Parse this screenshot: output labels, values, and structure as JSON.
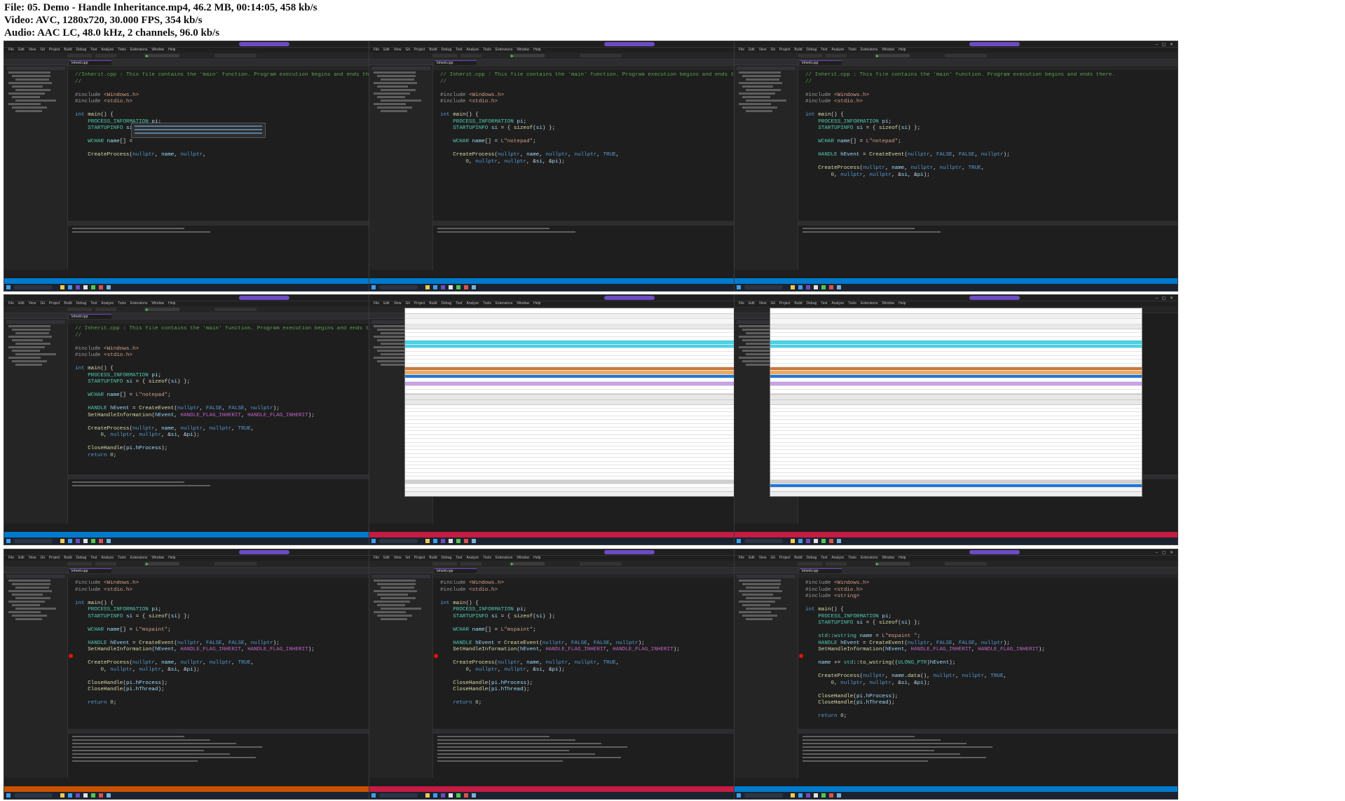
{
  "info": {
    "file_line": "File: 05. Demo - Handle Inheritance.mp4, 46.2 MB, 00:14:05, 458 kb/s",
    "video_line": "Video: AVC, 1280x720, 30.000 FPS, 354 kb/s",
    "audio_line": "Audio: AAC LC, 48.0 kHz, 2 channels, 96.0 kb/s"
  },
  "ide": {
    "menu": [
      "File",
      "Edit",
      "View",
      "Git",
      "Project",
      "Build",
      "Debug",
      "Test",
      "Analyze",
      "Tools",
      "Extensions",
      "Window",
      "Help"
    ],
    "tab_label": "Inherit.cpp",
    "accent": "#6d4bc3",
    "status_colors": {
      "normal": "#007acc",
      "debug": "#ca5100",
      "alt": "#c41c43"
    }
  },
  "frames": [
    {
      "id": "f1",
      "kind": "code",
      "status": "normal",
      "lines": [
        "//Inherit.cpp : This file contains the 'main' function. Program execution begins and ends there.",
        "//",
        "",
        "#include <Windows.h>",
        "#include <stdio.h>",
        "",
        "int main() {",
        "    PROCESS_INFORMATION pi;",
        "    STARTUPINFO si = { sizeof(si) };",
        "",
        "    WCHAR name[] =",
        "",
        "    CreateProcess(nullptr, name, nullptr,"
      ],
      "tooltip": true
    },
    {
      "id": "f2",
      "kind": "code",
      "status": "normal",
      "lines": [
        "// Inherit.cpp : This file contains the 'main' function. Program execution begins and ends there.",
        "//",
        "",
        "#include <Windows.h>",
        "#include <stdio.h>",
        "",
        "int main() {",
        "    PROCESS_INFORMATION pi;",
        "    STARTUPINFO si = { sizeof(si) };",
        "",
        "    WCHAR name[] = L\"notepad\";",
        "",
        "    CreateProcess(nullptr, name, nullptr, nullptr, TRUE,",
        "        0, nullptr, nullptr, &si, &pi);"
      ]
    },
    {
      "id": "f3",
      "kind": "code",
      "status": "normal",
      "lines": [
        "// Inherit.cpp : This file contains the 'main' function. Program execution begins and ends there.",
        "//",
        "",
        "#include <Windows.h>",
        "#include <stdio.h>",
        "",
        "int main() {",
        "    PROCESS_INFORMATION pi;",
        "    STARTUPINFO si = { sizeof(si) };",
        "",
        "    WCHAR name[] = L\"notepad\";",
        "",
        "    HANDLE hEvent = CreateEvent(nullptr, FALSE, FALSE, nullptr);",
        "",
        "    CreateProcess(nullptr, name, nullptr, nullptr, TRUE,",
        "        0, nullptr, nullptr, &si, &pi);"
      ]
    },
    {
      "id": "f4",
      "kind": "code",
      "status": "normal",
      "lines": [
        "// Inherit.cpp : This file contains the 'main' function. Program execution begins and ends there.",
        "//",
        "",
        "#include <Windows.h>",
        "#include <stdio.h>",
        "",
        "int main() {",
        "    PROCESS_INFORMATION pi;",
        "    STARTUPINFO si = { sizeof(si) };",
        "",
        "    WCHAR name[] = L\"notepad\";",
        "",
        "    HANDLE hEvent = CreateEvent(nullptr, FALSE, FALSE, nullptr);",
        "    SetHandleInformation(hEvent, HANDLE_FLAG_INHERIT, HANDLE_FLAG_INHERIT);",
        "",
        "    CreateProcess(nullptr, name, nullptr, nullptr, TRUE,",
        "        0, nullptr, nullptr, &si, &pi);",
        "",
        "    CloseHandle(pi.hProcess);",
        "    return 0;"
      ]
    },
    {
      "id": "f5",
      "kind": "procexp",
      "status": "alt",
      "selected": "right"
    },
    {
      "id": "f6",
      "kind": "procexp",
      "status": "alt",
      "selected": "left"
    },
    {
      "id": "f7",
      "kind": "code",
      "status": "debug",
      "breakpoint": true,
      "lines": [
        "#include <Windows.h>",
        "#include <stdio.h>",
        "",
        "int main() {",
        "    PROCESS_INFORMATION pi;",
        "    STARTUPINFO si = { sizeof(si) };",
        "",
        "    WCHAR name[] = L\"mspaint\";",
        "",
        "    HANDLE hEvent = CreateEvent(nullptr, FALSE, FALSE, nullptr);",
        "    SetHandleInformation(hEvent, HANDLE_FLAG_INHERIT, HANDLE_FLAG_INHERIT);",
        "",
        "    CreateProcess(nullptr, name, nullptr, nullptr, TRUE,",
        "        0, nullptr, nullptr, &si, &pi);",
        "",
        "    CloseHandle(pi.hProcess);",
        "    CloseHandle(pi.hThread);",
        "",
        "    return 0;"
      ]
    },
    {
      "id": "f8",
      "kind": "code",
      "status": "alt",
      "breakpoint": true,
      "lines": [
        "#include <Windows.h>",
        "#include <stdio.h>",
        "",
        "int main() {",
        "    PROCESS_INFORMATION pi;",
        "    STARTUPINFO si = { sizeof(si) };",
        "",
        "    WCHAR name[] = L\"mspaint\";",
        "",
        "    HANDLE hEvent = CreateEvent(nullptr, FALSE, FALSE, nullptr);",
        "    SetHandleInformation(hEvent, HANDLE_FLAG_INHERIT, HANDLE_FLAG_INHERIT);",
        "",
        "    CreateProcess(nullptr, name, nullptr, nullptr, TRUE,",
        "        0, nullptr, nullptr, &si, &pi);",
        "",
        "    CloseHandle(pi.hProcess);",
        "    CloseHandle(pi.hThread);",
        "",
        "    return 0;"
      ]
    },
    {
      "id": "f9",
      "kind": "code",
      "status": "normal",
      "breakpoint": true,
      "lines": [
        "#include <Windows.h>",
        "#include <stdio.h>",
        "#include <string>",
        "",
        "int main() {",
        "    PROCESS_INFORMATION pi;",
        "    STARTUPINFO si = { sizeof(si) };",
        "",
        "    std::wstring name = L\"mspaint \";",
        "    HANDLE hEvent = CreateEvent(nullptr, FALSE, FALSE, nullptr);",
        "    SetHandleInformation(hEvent, HANDLE_FLAG_INHERIT, HANDLE_FLAG_INHERIT);",
        "",
        "    name += std::to_wstring((ULONG_PTR)hEvent);",
        "",
        "    CreateProcess(nullptr, name.data(), nullptr, nullptr, TRUE,",
        "        0, nullptr, nullptr, &si, &pi);",
        "",
        "    CloseHandle(pi.hProcess);",
        "    CloseHandle(pi.hThread);",
        "",
        "    return 0;"
      ]
    }
  ],
  "procexp_rows_top": [
    "white",
    "white",
    "white",
    "cyan",
    "cyan",
    "white",
    "white",
    "white",
    "white",
    "white",
    "brown",
    "orange",
    "blue",
    "white",
    "purple",
    "white",
    "white"
  ],
  "procexp_rows_bottom_count": 22
}
